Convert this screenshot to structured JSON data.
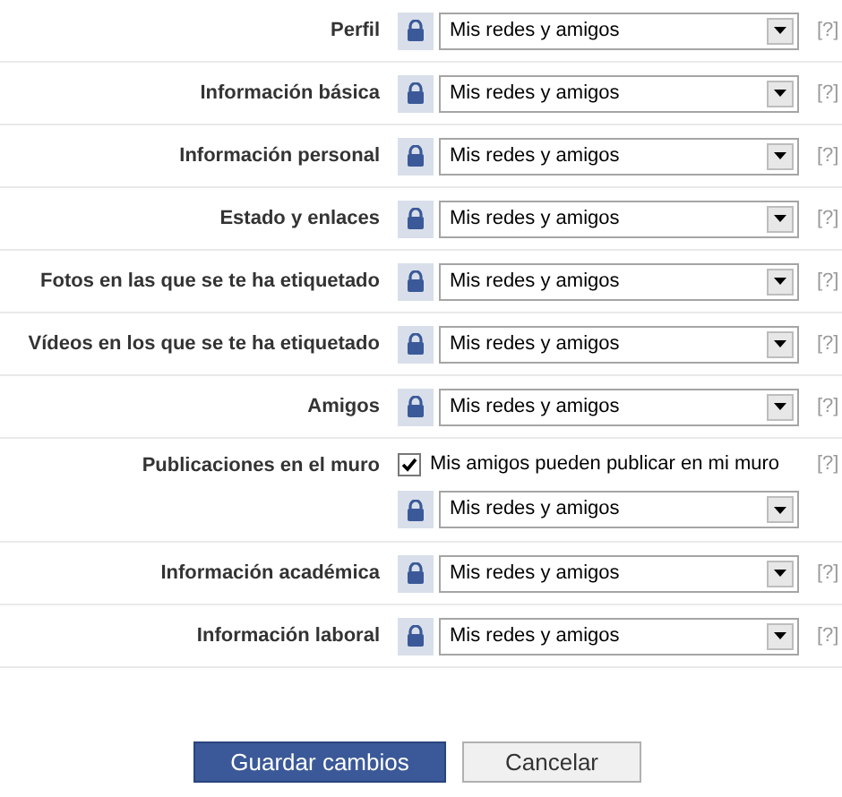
{
  "rows": [
    {
      "kind": "select",
      "label": "Perfil",
      "value": "Mis redes y amigos",
      "help": "[?]"
    },
    {
      "kind": "select",
      "label": "Información básica",
      "value": "Mis redes y amigos",
      "help": "[?]"
    },
    {
      "kind": "select",
      "label": "Información personal",
      "value": "Mis redes y amigos",
      "help": "[?]"
    },
    {
      "kind": "select",
      "label": "Estado y enlaces",
      "value": "Mis redes y amigos",
      "help": "[?]"
    },
    {
      "kind": "select",
      "label": "Fotos en las que se te ha etiquetado",
      "value": "Mis redes y amigos",
      "help": "[?]"
    },
    {
      "kind": "select",
      "label": "Vídeos en los que se te ha etiquetado",
      "value": "Mis redes y amigos",
      "help": "[?]"
    },
    {
      "kind": "select",
      "label": "Amigos",
      "value": "Mis redes y amigos",
      "help": "[?]"
    },
    {
      "kind": "wall",
      "label": "Publicaciones en el muro",
      "checkbox": {
        "label": "Mis amigos pueden publicar en mi muro",
        "checked": true
      },
      "value": "Mis redes y amigos",
      "help": "[?]"
    },
    {
      "kind": "select",
      "label": "Información académica",
      "value": "Mis redes y amigos",
      "help": "[?]"
    },
    {
      "kind": "select",
      "label": "Información laboral",
      "value": "Mis redes y amigos",
      "help": "[?]"
    }
  ],
  "buttons": [
    {
      "kind": "primary",
      "label": "Guardar cambios"
    },
    {
      "kind": "secondary",
      "label": "Cancelar"
    }
  ]
}
